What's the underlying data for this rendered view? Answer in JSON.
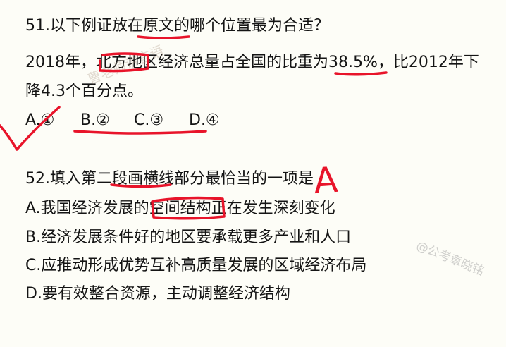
{
  "q51": {
    "stem": "51.以下例证放在原文的哪个位置最为合适？",
    "passage_line1": "2018年，北方地区经济总量占全国的比重为38.5%，比2012年下",
    "passage_line2": "降4.3个百分点。",
    "options": [
      {
        "label": "A.①"
      },
      {
        "label": "B.②"
      },
      {
        "label": "C.③"
      },
      {
        "label": "D.④"
      }
    ]
  },
  "q52": {
    "stem": "52.填入第二段画横线部分最恰当的一项是",
    "options": [
      {
        "text": "A.我国经济发展的空间结构正在发生深刻变化"
      },
      {
        "text": "B.经济发展条件好的地区要承载更多产业和人口"
      },
      {
        "text": "C.应推动形成优势互补高质量发展的区域经济布局"
      },
      {
        "text": "D.要有效整合资源，主动调整经济结构"
      }
    ]
  },
  "annotations": {
    "answer_mark": "A",
    "check_color": "#e8142a",
    "ink_color": "#e8142a"
  },
  "watermarks": {
    "center": "曹老师讲言语",
    "right": "@公考章晓铭"
  }
}
